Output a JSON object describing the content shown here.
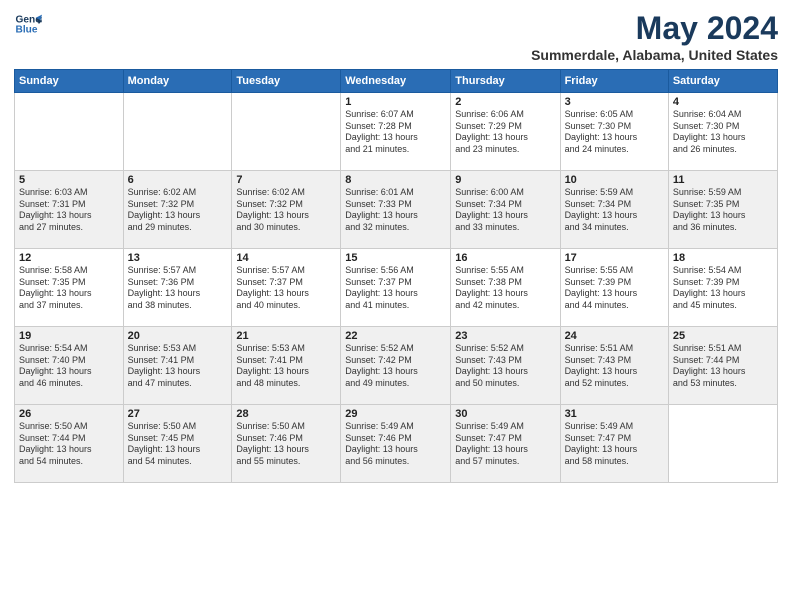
{
  "logo": {
    "line1": "General",
    "line2": "Blue"
  },
  "title": "May 2024",
  "subtitle": "Summerdale, Alabama, United States",
  "weekdays": [
    "Sunday",
    "Monday",
    "Tuesday",
    "Wednesday",
    "Thursday",
    "Friday",
    "Saturday"
  ],
  "weeks": [
    [
      {
        "day": "",
        "info": ""
      },
      {
        "day": "",
        "info": ""
      },
      {
        "day": "",
        "info": ""
      },
      {
        "day": "1",
        "info": "Sunrise: 6:07 AM\nSunset: 7:28 PM\nDaylight: 13 hours\nand 21 minutes."
      },
      {
        "day": "2",
        "info": "Sunrise: 6:06 AM\nSunset: 7:29 PM\nDaylight: 13 hours\nand 23 minutes."
      },
      {
        "day": "3",
        "info": "Sunrise: 6:05 AM\nSunset: 7:30 PM\nDaylight: 13 hours\nand 24 minutes."
      },
      {
        "day": "4",
        "info": "Sunrise: 6:04 AM\nSunset: 7:30 PM\nDaylight: 13 hours\nand 26 minutes."
      }
    ],
    [
      {
        "day": "5",
        "info": "Sunrise: 6:03 AM\nSunset: 7:31 PM\nDaylight: 13 hours\nand 27 minutes."
      },
      {
        "day": "6",
        "info": "Sunrise: 6:02 AM\nSunset: 7:32 PM\nDaylight: 13 hours\nand 29 minutes."
      },
      {
        "day": "7",
        "info": "Sunrise: 6:02 AM\nSunset: 7:32 PM\nDaylight: 13 hours\nand 30 minutes."
      },
      {
        "day": "8",
        "info": "Sunrise: 6:01 AM\nSunset: 7:33 PM\nDaylight: 13 hours\nand 32 minutes."
      },
      {
        "day": "9",
        "info": "Sunrise: 6:00 AM\nSunset: 7:34 PM\nDaylight: 13 hours\nand 33 minutes."
      },
      {
        "day": "10",
        "info": "Sunrise: 5:59 AM\nSunset: 7:34 PM\nDaylight: 13 hours\nand 34 minutes."
      },
      {
        "day": "11",
        "info": "Sunrise: 5:59 AM\nSunset: 7:35 PM\nDaylight: 13 hours\nand 36 minutes."
      }
    ],
    [
      {
        "day": "12",
        "info": "Sunrise: 5:58 AM\nSunset: 7:35 PM\nDaylight: 13 hours\nand 37 minutes."
      },
      {
        "day": "13",
        "info": "Sunrise: 5:57 AM\nSunset: 7:36 PM\nDaylight: 13 hours\nand 38 minutes."
      },
      {
        "day": "14",
        "info": "Sunrise: 5:57 AM\nSunset: 7:37 PM\nDaylight: 13 hours\nand 40 minutes."
      },
      {
        "day": "15",
        "info": "Sunrise: 5:56 AM\nSunset: 7:37 PM\nDaylight: 13 hours\nand 41 minutes."
      },
      {
        "day": "16",
        "info": "Sunrise: 5:55 AM\nSunset: 7:38 PM\nDaylight: 13 hours\nand 42 minutes."
      },
      {
        "day": "17",
        "info": "Sunrise: 5:55 AM\nSunset: 7:39 PM\nDaylight: 13 hours\nand 44 minutes."
      },
      {
        "day": "18",
        "info": "Sunrise: 5:54 AM\nSunset: 7:39 PM\nDaylight: 13 hours\nand 45 minutes."
      }
    ],
    [
      {
        "day": "19",
        "info": "Sunrise: 5:54 AM\nSunset: 7:40 PM\nDaylight: 13 hours\nand 46 minutes."
      },
      {
        "day": "20",
        "info": "Sunrise: 5:53 AM\nSunset: 7:41 PM\nDaylight: 13 hours\nand 47 minutes."
      },
      {
        "day": "21",
        "info": "Sunrise: 5:53 AM\nSunset: 7:41 PM\nDaylight: 13 hours\nand 48 minutes."
      },
      {
        "day": "22",
        "info": "Sunrise: 5:52 AM\nSunset: 7:42 PM\nDaylight: 13 hours\nand 49 minutes."
      },
      {
        "day": "23",
        "info": "Sunrise: 5:52 AM\nSunset: 7:43 PM\nDaylight: 13 hours\nand 50 minutes."
      },
      {
        "day": "24",
        "info": "Sunrise: 5:51 AM\nSunset: 7:43 PM\nDaylight: 13 hours\nand 52 minutes."
      },
      {
        "day": "25",
        "info": "Sunrise: 5:51 AM\nSunset: 7:44 PM\nDaylight: 13 hours\nand 53 minutes."
      }
    ],
    [
      {
        "day": "26",
        "info": "Sunrise: 5:50 AM\nSunset: 7:44 PM\nDaylight: 13 hours\nand 54 minutes."
      },
      {
        "day": "27",
        "info": "Sunrise: 5:50 AM\nSunset: 7:45 PM\nDaylight: 13 hours\nand 54 minutes."
      },
      {
        "day": "28",
        "info": "Sunrise: 5:50 AM\nSunset: 7:46 PM\nDaylight: 13 hours\nand 55 minutes."
      },
      {
        "day": "29",
        "info": "Sunrise: 5:49 AM\nSunset: 7:46 PM\nDaylight: 13 hours\nand 56 minutes."
      },
      {
        "day": "30",
        "info": "Sunrise: 5:49 AM\nSunset: 7:47 PM\nDaylight: 13 hours\nand 57 minutes."
      },
      {
        "day": "31",
        "info": "Sunrise: 5:49 AM\nSunset: 7:47 PM\nDaylight: 13 hours\nand 58 minutes."
      },
      {
        "day": "",
        "info": ""
      }
    ]
  ]
}
